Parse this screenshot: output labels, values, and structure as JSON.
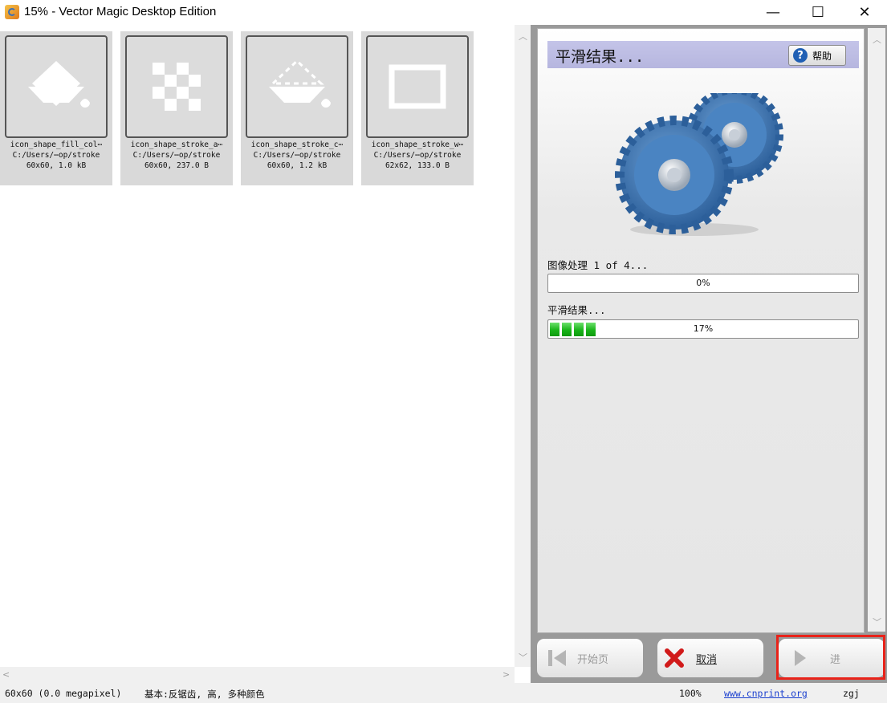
{
  "window": {
    "title": "15% - Vector Magic Desktop Edition",
    "minimize_glyph": "—",
    "maximize_glyph": "☐",
    "close_glyph": "✕"
  },
  "thumbnails": [
    {
      "icon": "paint-bucket-fill-icon",
      "name": "icon_shape_fill_col⋯",
      "path": "C:/Users/⋯op/stroke",
      "info": "60x60, 1.0 kB"
    },
    {
      "icon": "checkerboard-icon",
      "name": "icon_shape_stroke_a⋯",
      "path": "C:/Users/⋯op/stroke",
      "info": "60x60, 237.0 B"
    },
    {
      "icon": "paint-bucket-dashed-icon",
      "name": "icon_shape_stroke_c⋯",
      "path": "C:/Users/⋯op/stroke",
      "info": "60x60, 1.2 kB"
    },
    {
      "icon": "rectangle-outline-icon",
      "name": "icon_shape_stroke_w⋯",
      "path": "C:/Users/⋯op/stroke",
      "info": "62x62, 133.0 B"
    }
  ],
  "panel": {
    "heading": "平滑结果...",
    "help_label": "帮助",
    "image_progress_label": "图像处理 1 of 4...",
    "image_progress_percent": "0%",
    "image_progress_value": 0.0,
    "smooth_label": "平滑结果...",
    "smooth_percent": "17%",
    "smooth_value": 0.17
  },
  "buttons": {
    "start_label": "开始页",
    "cancel_label": "取消",
    "next_label": "进"
  },
  "status": {
    "image_info": "60x60 (0.0 megapixel)",
    "settings": "基本:反锯齿, 高, 多种颜色",
    "zoom": "100%",
    "link": "www.cnprint.org",
    "user": "zgj"
  },
  "colors": {
    "header_bg": "#b6b6df",
    "progress_fill": "#19b419",
    "highlight": "#e8231a",
    "gear": "#3f78b5"
  }
}
